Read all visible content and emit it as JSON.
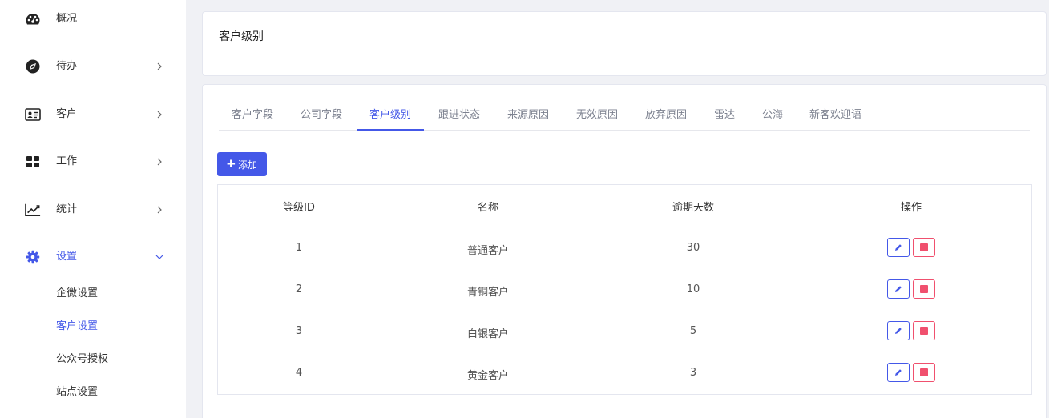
{
  "sidebar": {
    "items": [
      {
        "label": "概况",
        "icon": "dashboard-icon",
        "arrow": ""
      },
      {
        "label": "待办",
        "icon": "compass-icon",
        "arrow": "›"
      },
      {
        "label": "客户",
        "icon": "id-card-icon",
        "arrow": "›"
      },
      {
        "label": "工作",
        "icon": "grid-icon",
        "arrow": "›"
      },
      {
        "label": "统计",
        "icon": "line-chart-icon",
        "arrow": "›"
      },
      {
        "label": "设置",
        "icon": "gear-icon",
        "arrow": "⌄",
        "active": true
      }
    ],
    "submenu": [
      {
        "label": "企微设置"
      },
      {
        "label": "客户设置",
        "active": true
      },
      {
        "label": "公众号授权"
      },
      {
        "label": "站点设置"
      }
    ]
  },
  "header": {
    "title": "客户级别"
  },
  "tabs": [
    {
      "label": "客户字段"
    },
    {
      "label": "公司字段"
    },
    {
      "label": "客户级别",
      "active": true
    },
    {
      "label": "跟进状态"
    },
    {
      "label": "来源原因"
    },
    {
      "label": "无效原因"
    },
    {
      "label": "放弃原因"
    },
    {
      "label": "雷达"
    },
    {
      "label": "公海"
    },
    {
      "label": "新客欢迎语"
    }
  ],
  "add_button": {
    "label": "添加",
    "plus": "✚"
  },
  "table": {
    "columns": [
      "等级ID",
      "名称",
      "逾期天数",
      "操作"
    ],
    "rows": [
      {
        "id": "1",
        "name": "普通客户",
        "days": "30"
      },
      {
        "id": "2",
        "name": "青铜客户",
        "days": "10"
      },
      {
        "id": "3",
        "name": "白银客户",
        "days": "5"
      },
      {
        "id": "4",
        "name": "黄金客户",
        "days": "3"
      }
    ]
  },
  "colors": {
    "accent": "#4458e8",
    "danger": "#f0506e",
    "background": "#f0f1f5"
  }
}
